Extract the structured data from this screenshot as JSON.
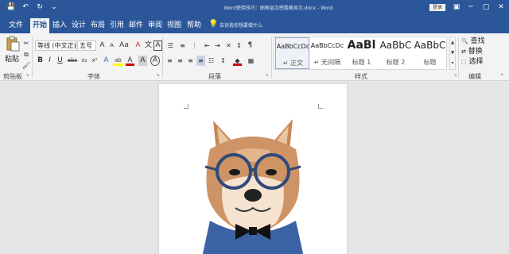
{
  "titlebar": {
    "doc_title": "Word使用技巧：图表层次感粗略显示.docx - Word",
    "login": "登录",
    "qat": {
      "save_icon": "💾",
      "undo_icon": "↶",
      "redo_icon": "↻",
      "more_icon": "⌄"
    },
    "controls": {
      "minimize": "─",
      "restore": "▢",
      "close": "✕",
      "ribbon_options": "▣"
    }
  },
  "tabs": [
    "文件",
    "开始",
    "插入",
    "设计",
    "布局",
    "引用",
    "邮件",
    "审阅",
    "视图",
    "帮助"
  ],
  "active_tab": "开始",
  "tell_me": {
    "icon": "💡",
    "text": "告诉我你想要做什么"
  },
  "clipboard": {
    "paste": "粘贴",
    "label": "剪贴板"
  },
  "font": {
    "name": "等线 (中文正)",
    "size": "五号",
    "grow": "A",
    "shrink": "A",
    "case": "Aa",
    "clear": "A",
    "phonetic": "文",
    "border": "A",
    "bold": "B",
    "italic": "I",
    "underline": "U",
    "strike": "abc",
    "sub": "x₂",
    "sup": "x²",
    "effects": "A",
    "highlight": "ab",
    "color": "A",
    "shade": "A",
    "enclose": "A",
    "label": "字体"
  },
  "paragraph": {
    "label": "段落"
  },
  "styles": {
    "label": "样式",
    "items": [
      {
        "preview": "AaBbCcDc",
        "name": "↵ 正文"
      },
      {
        "preview": "AaBbCcDc",
        "name": "↵ 无间隔"
      },
      {
        "preview": "AaBl",
        "name": "标题 1"
      },
      {
        "preview": "AaBbC",
        "name": "标题 2"
      },
      {
        "preview": "AaBbC",
        "name": "标题"
      }
    ]
  },
  "editing": {
    "label": "编辑",
    "find": "查找",
    "replace": "替换",
    "select": "选择",
    "find_icon": "🔍",
    "replace_icon": "⇄",
    "select_icon": "⬚"
  },
  "colors": {
    "accent": "#2b579a",
    "ribbon": "#f3f3f3",
    "canvas": "#e6e6e6",
    "highlight_yellow": "#ffff00",
    "font_red": "#d00000"
  }
}
